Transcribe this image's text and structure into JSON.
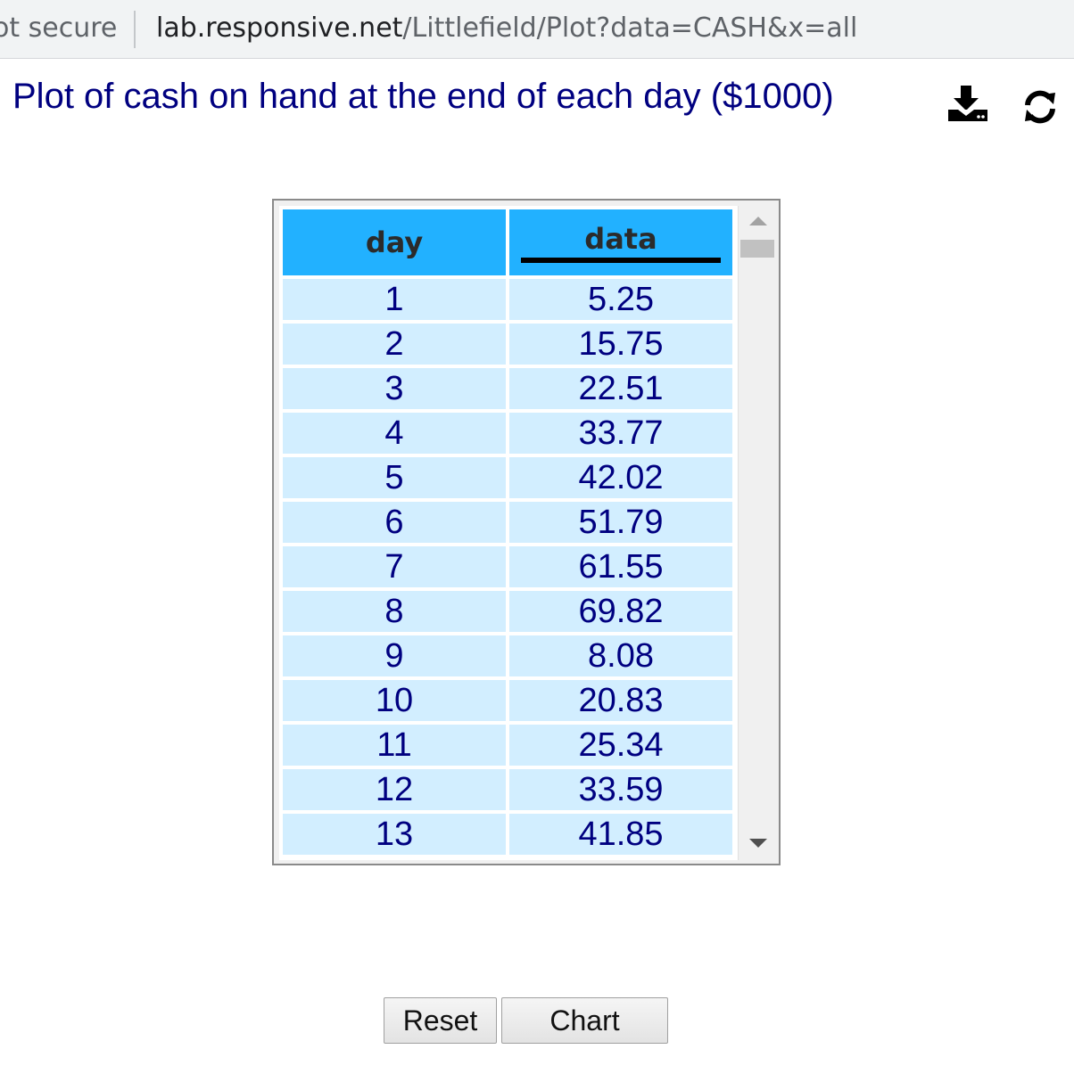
{
  "browser": {
    "security_text": "ot secure",
    "url_host": "lab.responsive.net",
    "url_path": "/Littlefield/Plot?data=CASH&x=all"
  },
  "page": {
    "title": "Plot of cash on hand at the end of each day ($1000)",
    "icons": [
      "download-icon",
      "refresh-icon"
    ]
  },
  "table": {
    "columns": [
      "day",
      "data"
    ],
    "rows": [
      [
        "1",
        "5.25"
      ],
      [
        "2",
        "15.75"
      ],
      [
        "3",
        "22.51"
      ],
      [
        "4",
        "33.77"
      ],
      [
        "5",
        "42.02"
      ],
      [
        "6",
        "51.79"
      ],
      [
        "7",
        "61.55"
      ],
      [
        "8",
        "69.82"
      ],
      [
        "9",
        "8.08"
      ],
      [
        "10",
        "20.83"
      ],
      [
        "11",
        "25.34"
      ],
      [
        "12",
        "33.59"
      ],
      [
        "13",
        "41.85"
      ]
    ]
  },
  "buttons": {
    "reset_label": "Reset",
    "chart_label": "Chart"
  },
  "colors": {
    "title": "#000080",
    "header_bg": "#22b1ff",
    "cell_bg": "#d2eeff"
  }
}
